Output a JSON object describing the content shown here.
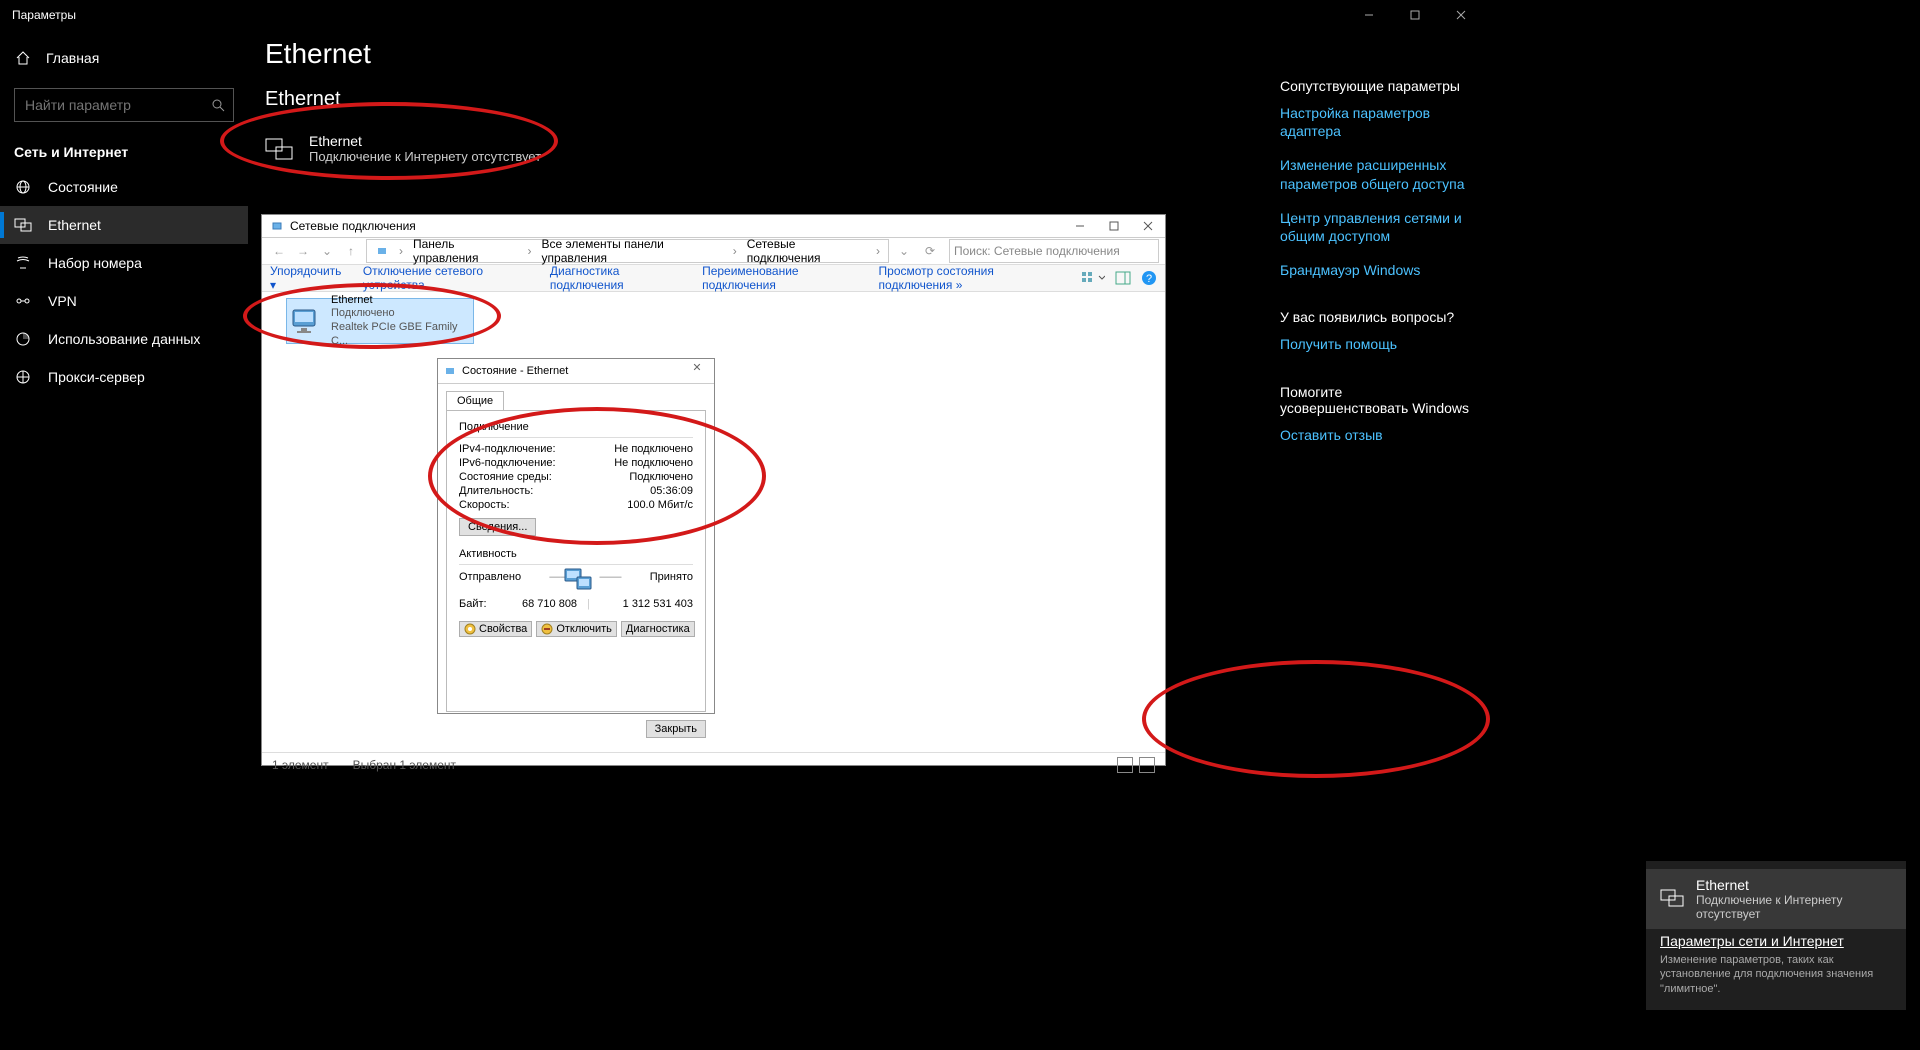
{
  "window": {
    "title": "Параметры"
  },
  "sidebar": {
    "home": "Главная",
    "search_placeholder": "Найти параметр",
    "category": "Сеть и Интернет",
    "items": [
      {
        "label": "Состояние"
      },
      {
        "label": "Ethernet"
      },
      {
        "label": "Набор номера"
      },
      {
        "label": "VPN"
      },
      {
        "label": "Использование данных"
      },
      {
        "label": "Прокси-сервер"
      }
    ]
  },
  "page": {
    "title": "Ethernet",
    "section": "Ethernet",
    "eth_name": "Ethernet",
    "eth_status": "Подключение к Интернету отсутствует"
  },
  "right": {
    "related_head": "Сопутствующие параметры",
    "links": [
      "Настройка параметров адаптера",
      "Изменение расширенных параметров общего доступа",
      "Центр управления сетями и общим доступом",
      "Брандмауэр Windows"
    ],
    "q_head": "У вас появились вопросы?",
    "q_link": "Получить помощь",
    "imp_head": "Помогите усовершенствовать Windows",
    "imp_link": "Оставить отзыв"
  },
  "nc": {
    "title": "Сетевые подключения",
    "path": [
      "Панель управления",
      "Все элементы панели управления",
      "Сетевые подключения"
    ],
    "search_placeholder": "Поиск: Сетевые подключения",
    "toolbar": {
      "organize": "Упорядочить",
      "disable": "Отключение сетевого устройства",
      "diag": "Диагностика подключения",
      "rename": "Переименование подключения",
      "viewstatus": "Просмотр состояния подключения"
    },
    "item": {
      "name": "Ethernet",
      "status": "Подключено",
      "device": "Realtek PCIe GBE Family C..."
    },
    "statusbar": {
      "count": "1 элемент",
      "selected": "Выбран 1 элемент"
    }
  },
  "dlg": {
    "title": "Состояние - Ethernet",
    "tab": "Общие",
    "grp1": "Подключение",
    "rows1": [
      {
        "l": "IPv4-подключение:",
        "r": "Не подключено"
      },
      {
        "l": "IPv6-подключение:",
        "r": "Не подключено"
      },
      {
        "l": "Состояние среды:",
        "r": "Подключено"
      },
      {
        "l": "Длительность:",
        "r": "05:36:09"
      },
      {
        "l": "Скорость:",
        "r": "100.0 Мбит/с"
      }
    ],
    "details": "Сведения...",
    "grp2": "Активность",
    "sent": "Отправлено",
    "recv": "Принято",
    "bytes_label": "Байт:",
    "bytes_sent": "68 710 808",
    "bytes_recv": "1 312 531 403",
    "btn_props": "Свойства",
    "btn_disable": "Отключить",
    "btn_diag": "Диагностика",
    "btn_close": "Закрыть"
  },
  "flyout": {
    "name": "Ethernet",
    "status": "Подключение к Интернету отсутствует",
    "settings_head": "Параметры сети и Интернет",
    "settings_sub": "Изменение параметров, таких как установление для подключения значения \"лимитное\"."
  }
}
